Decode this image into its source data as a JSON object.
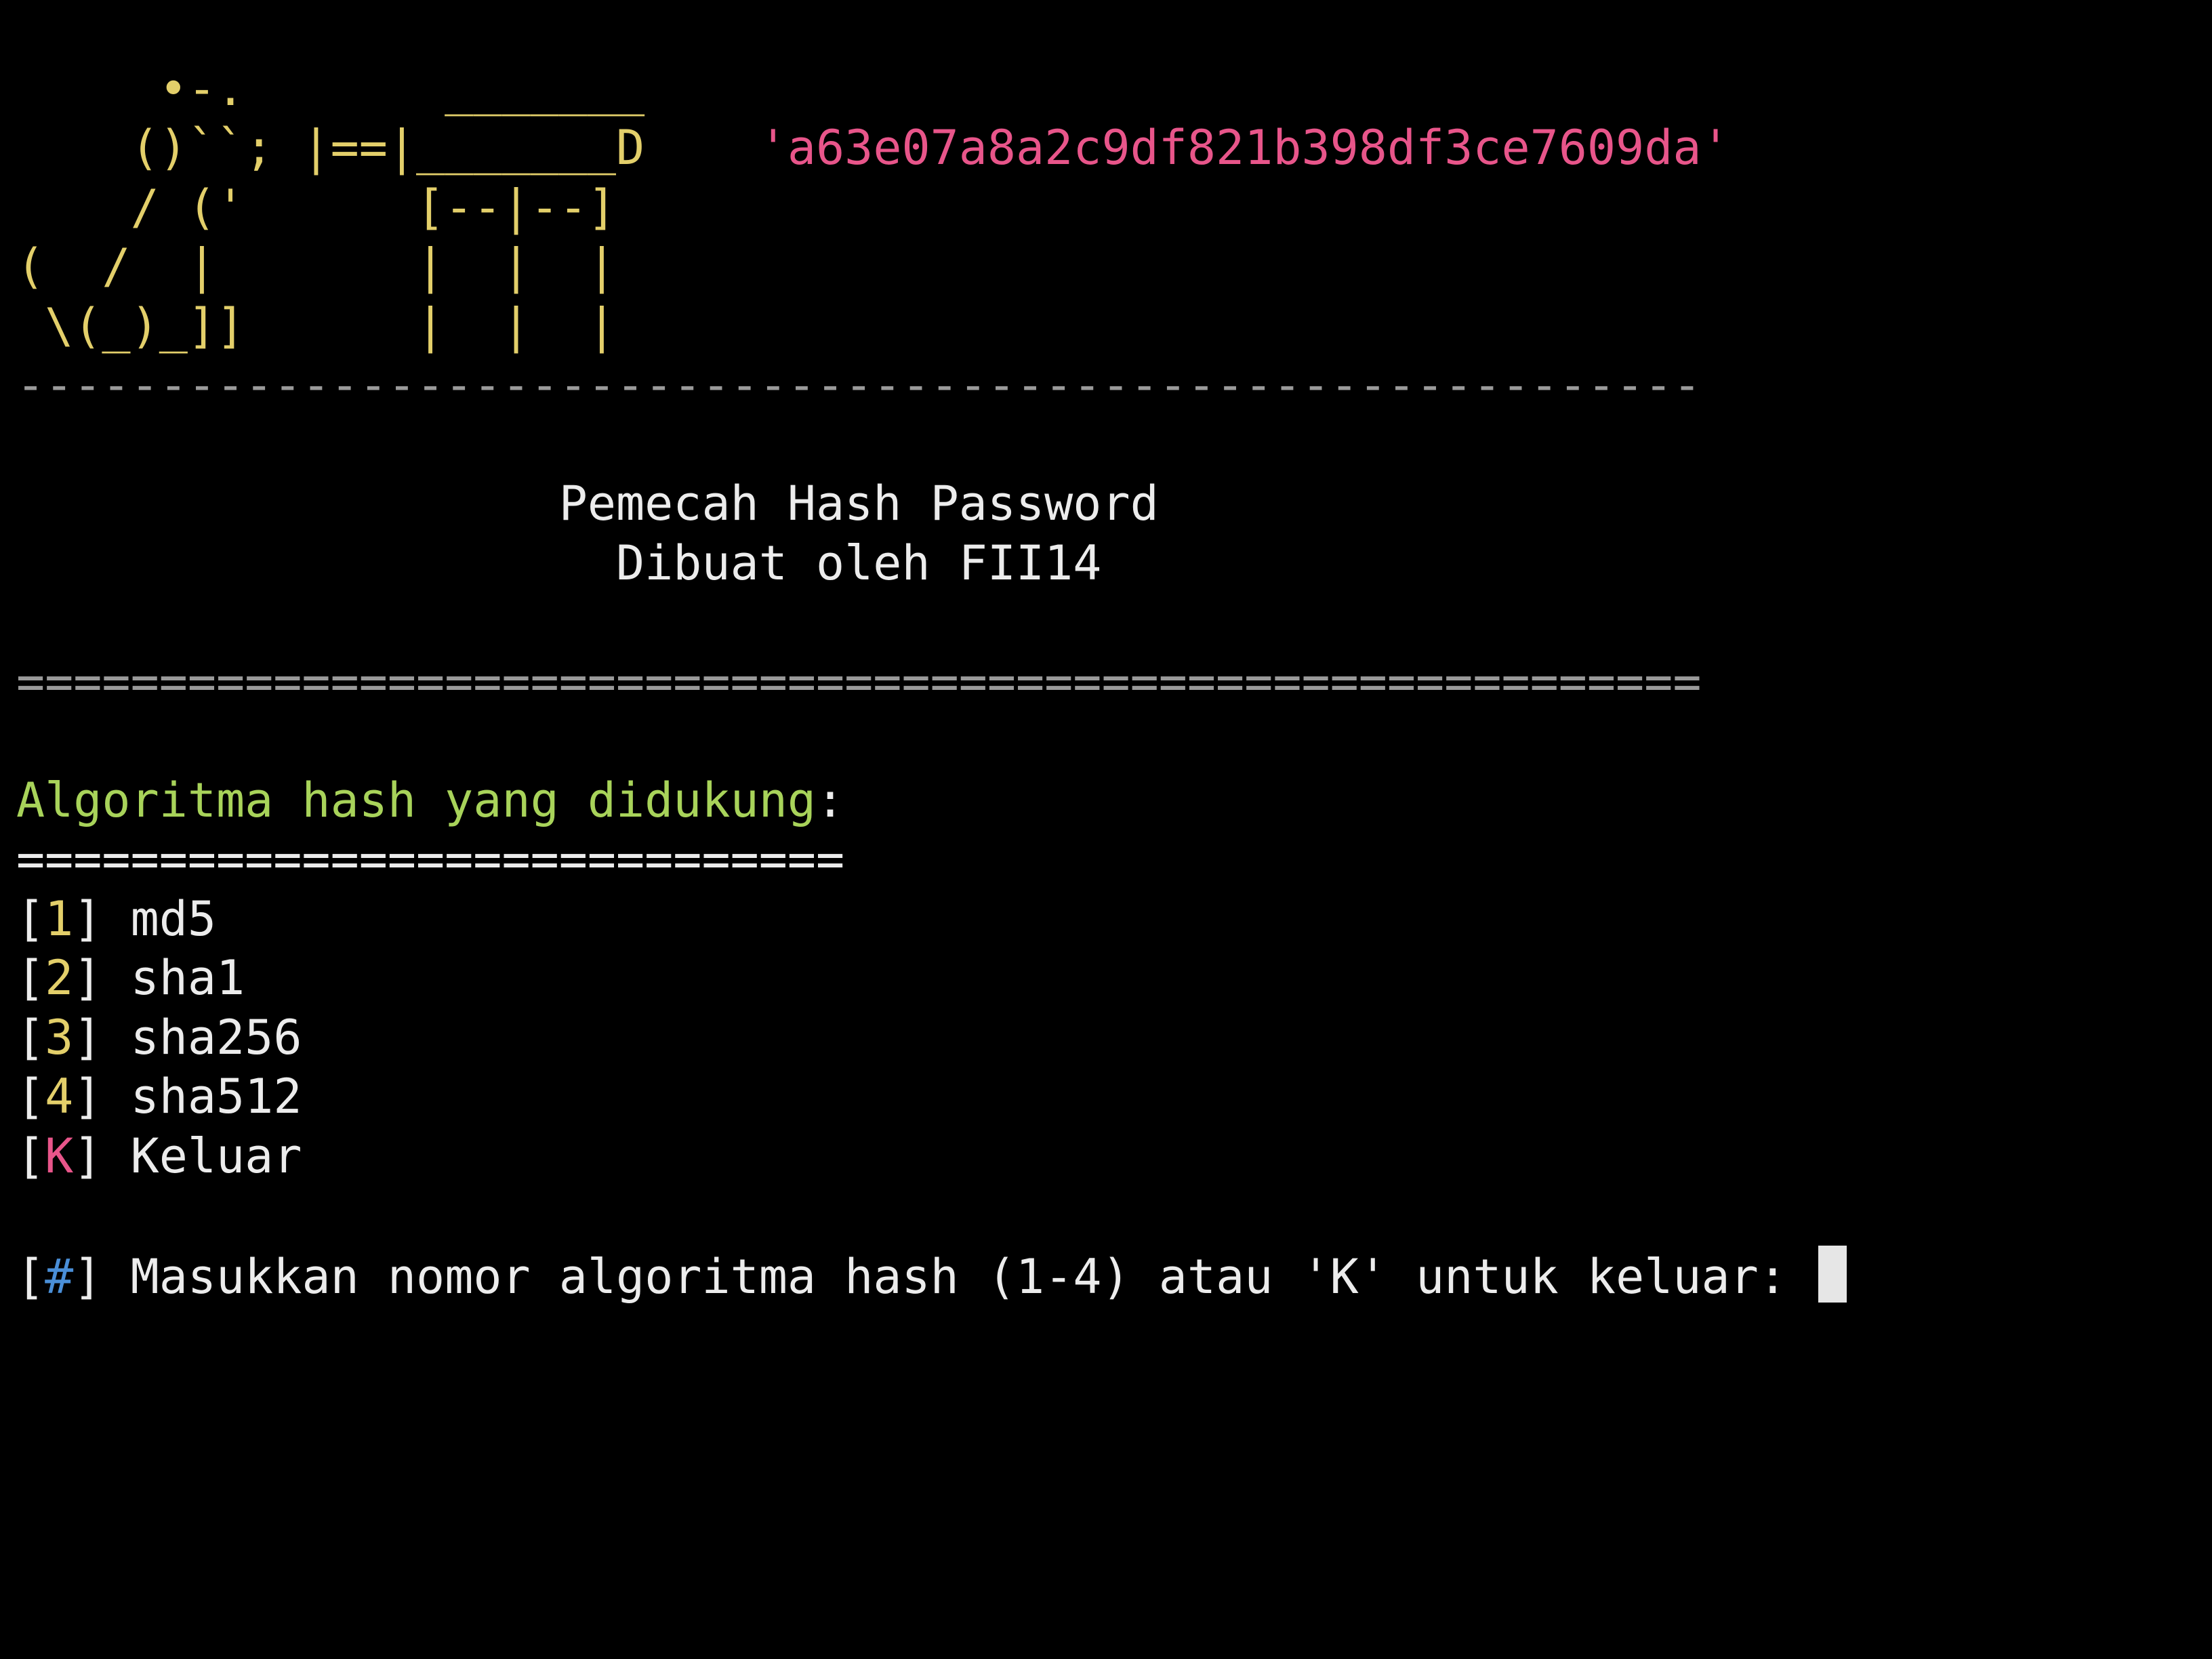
{
  "banner": {
    "art_lines": [
      "     •-.       _______",
      "    ()``; |==|_______D",
      "    / ('      [--|--]",
      "(  /  |       |  |  |",
      " \\(_)_]]      |  |  |"
    ],
    "hash_text": "'a63e07a8a2c9df821b398df3ce7609da'"
  },
  "separator_dash": "-----------------------------------------------------------",
  "title": {
    "line1": "                   Pemecah Hash Password",
    "line2": "                     Dibuat oleh FII14"
  },
  "separator_equal": "===========================================================",
  "menu": {
    "heading": "Algoritma hash yang didukung",
    "heading_colon": ":",
    "heading_underline": "=============================",
    "items": [
      {
        "key": "1",
        "label": "md5"
      },
      {
        "key": "2",
        "label": "sha1"
      },
      {
        "key": "3",
        "label": "sha256"
      },
      {
        "key": "4",
        "label": "sha512"
      },
      {
        "key": "K",
        "label": "Keluar"
      }
    ]
  },
  "prompt": {
    "symbol": "#",
    "text": "Masukkan nomor algoritma hash (1-4) atau 'K' untuk keluar: "
  },
  "colors": {
    "background": "#000000",
    "art": "#e3cf6a",
    "hash": "#e8558a",
    "heading": "#a8d35a",
    "separator": "#9a9a9a",
    "prompt_symbol": "#4a8fd8",
    "exit_key": "#e8558a",
    "text": "#e6e6e6"
  }
}
